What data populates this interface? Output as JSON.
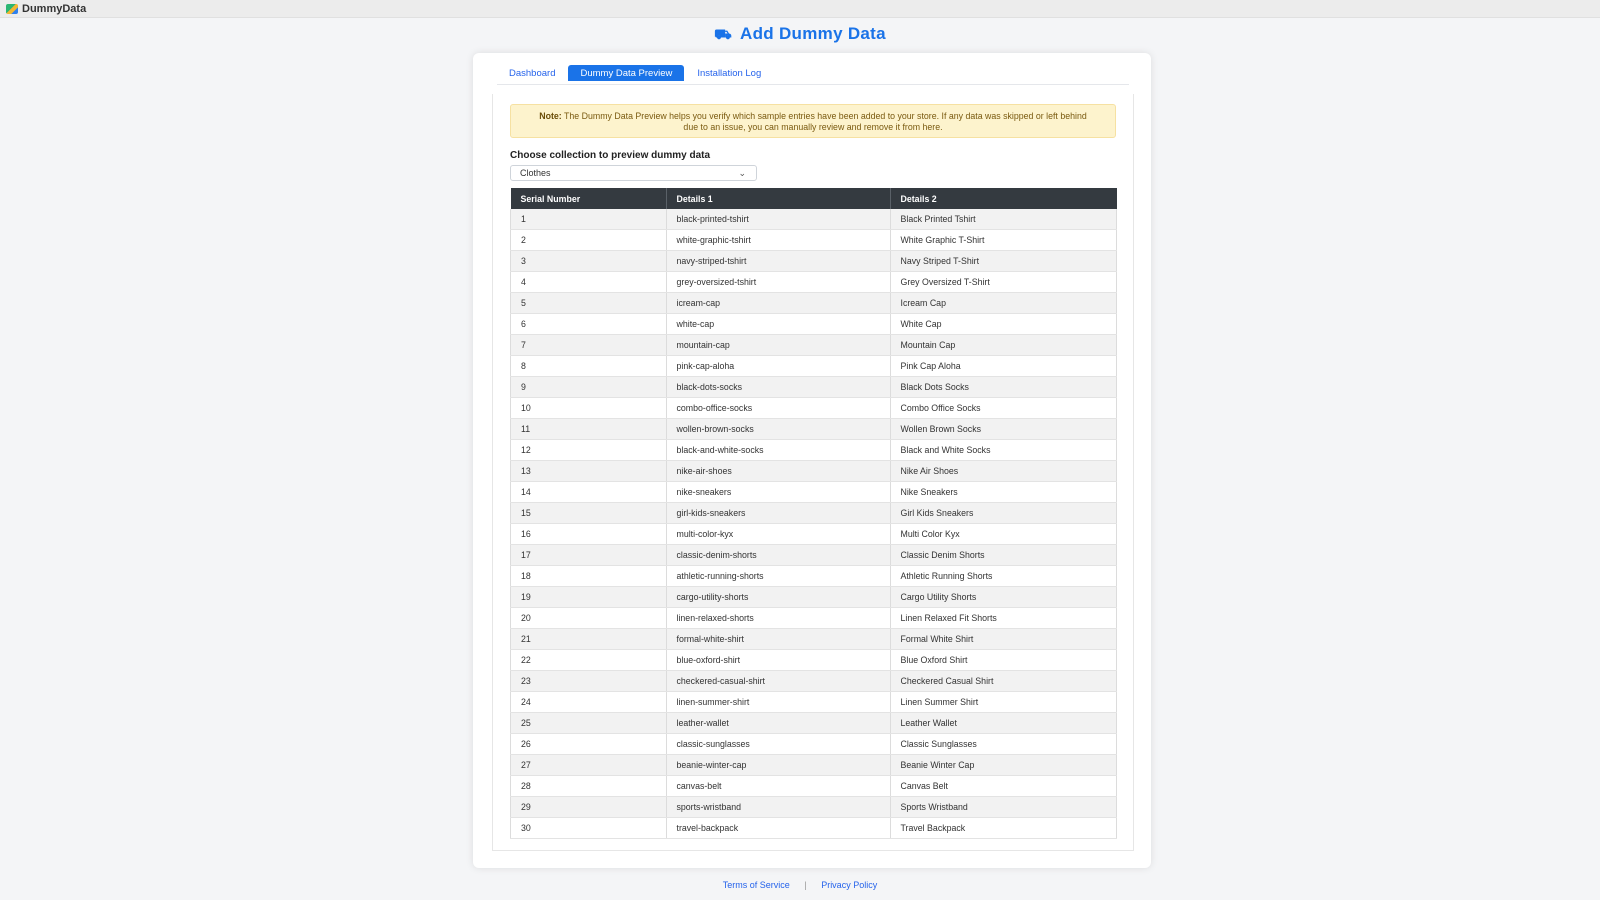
{
  "app": {
    "name": "DummyData"
  },
  "header": {
    "icon": "truck-icon",
    "title": "Add Dummy Data"
  },
  "tabs": [
    {
      "label": "Dashboard",
      "active": false
    },
    {
      "label": "Dummy Data Preview",
      "active": true
    },
    {
      "label": "Installation Log",
      "active": false
    }
  ],
  "note": {
    "bold": "Note:",
    "text": "The Dummy Data Preview helps you verify which sample entries have been added to your store. If any data was skipped or left behind due to an issue, you can manually review and remove it from here."
  },
  "collection": {
    "label": "Choose collection to preview dummy data",
    "selected": "Clothes"
  },
  "table": {
    "headers": [
      "Serial Number",
      "Details 1",
      "Details 2"
    ],
    "rows": [
      [
        "1",
        "black-printed-tshirt",
        "Black Printed Tshirt"
      ],
      [
        "2",
        "white-graphic-tshirt",
        "White Graphic T-Shirt"
      ],
      [
        "3",
        "navy-striped-tshirt",
        "Navy Striped T-Shirt"
      ],
      [
        "4",
        "grey-oversized-tshirt",
        "Grey Oversized T-Shirt"
      ],
      [
        "5",
        "icream-cap",
        "Icream Cap"
      ],
      [
        "6",
        "white-cap",
        "White Cap"
      ],
      [
        "7",
        "mountain-cap",
        "Mountain Cap"
      ],
      [
        "8",
        "pink-cap-aloha",
        "Pink Cap Aloha"
      ],
      [
        "9",
        "black-dots-socks",
        "Black Dots Socks"
      ],
      [
        "10",
        "combo-office-socks",
        "Combo Office Socks"
      ],
      [
        "11",
        "wollen-brown-socks",
        "Wollen Brown Socks"
      ],
      [
        "12",
        "black-and-white-socks",
        "Black and White Socks"
      ],
      [
        "13",
        "nike-air-shoes",
        "Nike Air Shoes"
      ],
      [
        "14",
        "nike-sneakers",
        "Nike Sneakers"
      ],
      [
        "15",
        "girl-kids-sneakers",
        "Girl Kids Sneakers"
      ],
      [
        "16",
        "multi-color-kyx",
        "Multi Color Kyx"
      ],
      [
        "17",
        "classic-denim-shorts",
        "Classic Denim Shorts"
      ],
      [
        "18",
        "athletic-running-shorts",
        "Athletic Running Shorts"
      ],
      [
        "19",
        "cargo-utility-shorts",
        "Cargo Utility Shorts"
      ],
      [
        "20",
        "linen-relaxed-shorts",
        "Linen Relaxed Fit Shorts"
      ],
      [
        "21",
        "formal-white-shirt",
        "Formal White Shirt"
      ],
      [
        "22",
        "blue-oxford-shirt",
        "Blue Oxford Shirt"
      ],
      [
        "23",
        "checkered-casual-shirt",
        "Checkered Casual Shirt"
      ],
      [
        "24",
        "linen-summer-shirt",
        "Linen Summer Shirt"
      ],
      [
        "25",
        "leather-wallet",
        "Leather Wallet"
      ],
      [
        "26",
        "classic-sunglasses",
        "Classic Sunglasses"
      ],
      [
        "27",
        "beanie-winter-cap",
        "Beanie Winter Cap"
      ],
      [
        "28",
        "canvas-belt",
        "Canvas Belt"
      ],
      [
        "29",
        "sports-wristband",
        "Sports Wristband"
      ],
      [
        "30",
        "travel-backpack",
        "Travel Backpack"
      ]
    ]
  },
  "footer": {
    "terms": "Terms of Service",
    "separator": "|",
    "privacy": "Privacy Policy"
  }
}
